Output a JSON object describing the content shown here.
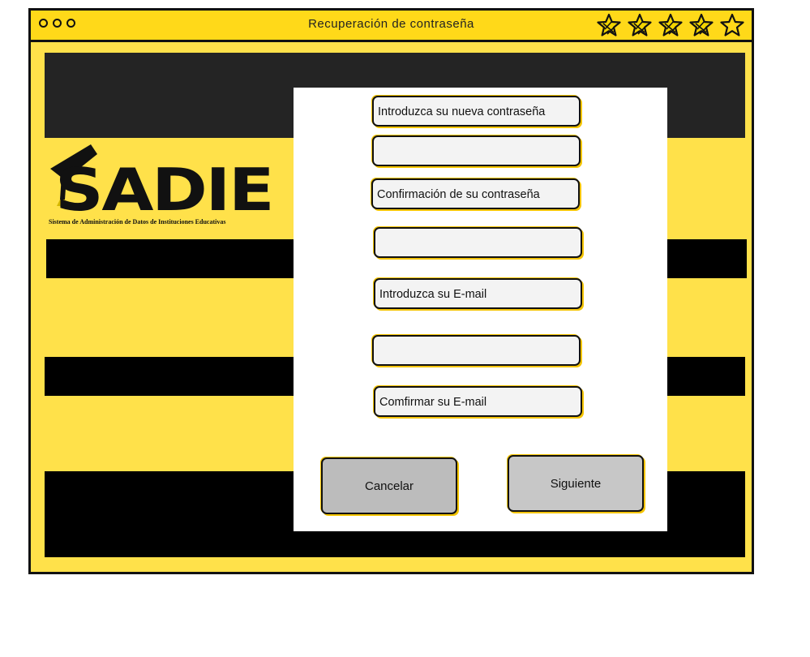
{
  "window": {
    "title": "Recuperación de contraseña"
  },
  "rating": {
    "filled": 4,
    "total": 5
  },
  "logo": {
    "text": "SADIE",
    "subtitle": "Sistema de Administración de Datos de Instituciones Educativas"
  },
  "form": {
    "new_password_label": "Introduzca su nueva contraseña",
    "confirm_password_label": "Confirmación de su contraseña",
    "email_label": "Introduzca su E-mail",
    "confirm_email_label": "Comfirmar su E-mail",
    "new_password_value": "",
    "confirm_password_value": "",
    "email_value": ""
  },
  "buttons": {
    "cancel": "Cancelar",
    "next": "Siguiente"
  },
  "colors": {
    "accent": "#ffd919",
    "background": "#ffe14a",
    "dark": "#000000"
  }
}
